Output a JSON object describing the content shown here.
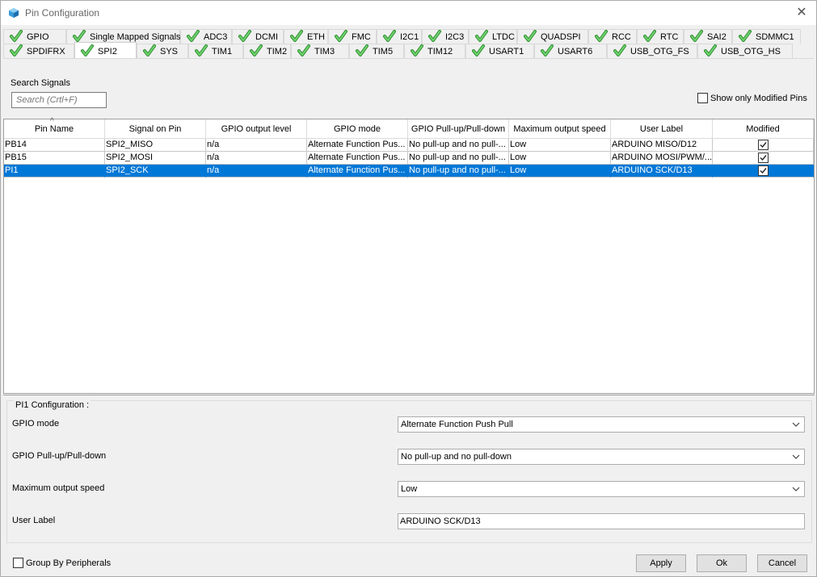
{
  "window": {
    "title": "Pin Configuration"
  },
  "tabs_row1": [
    "GPIO",
    "Single Mapped Signals",
    "ADC3",
    "DCMI",
    "ETH",
    "FMC",
    "I2C1",
    "I2C3",
    "LTDC",
    "QUADSPI",
    "RCC",
    "RTC",
    "SAI2",
    "SDMMC1"
  ],
  "tabs_row2": [
    "SPDIFRX",
    "SPI2",
    "SYS",
    "TIM1",
    "TIM2",
    "TIM3",
    "TIM5",
    "TIM12",
    "USART1",
    "USART6",
    "USB_OTG_FS",
    "USB_OTG_HS"
  ],
  "active_tab": "SPI2",
  "search": {
    "label": "Search Signals",
    "placeholder": "Search (Crtl+F)"
  },
  "show_modified": {
    "label": "Show only Modified Pins",
    "checked": false
  },
  "table": {
    "headers": [
      "Pin Name",
      "Signal on Pin",
      "GPIO output level",
      "GPIO mode",
      "GPIO Pull-up/Pull-down",
      "Maximum output speed",
      "User Label",
      "Modified"
    ],
    "rows": [
      [
        "PB14",
        "SPI2_MISO",
        "n/a",
        "Alternate Function Pus...",
        "No pull-up and no pull-...",
        "Low",
        "ARDUINO MISO/D12",
        true
      ],
      [
        "PB15",
        "SPI2_MOSI",
        "n/a",
        "Alternate Function Pus...",
        "No pull-up and no pull-...",
        "Low",
        "ARDUINO MOSI/PWM/...",
        true
      ],
      [
        "PI1",
        "SPI2_SCK",
        "n/a",
        "Alternate Function Pus...",
        "No pull-up and no pull-...",
        "Low",
        "ARDUINO SCK/D13",
        true
      ]
    ],
    "selected_row": 2
  },
  "config": {
    "title": "PI1 Configuration :",
    "fields": {
      "gpio_mode": {
        "label": "GPIO mode",
        "value": "Alternate Function Push Pull"
      },
      "pull": {
        "label": "GPIO Pull-up/Pull-down",
        "value": "No pull-up and no pull-down"
      },
      "speed": {
        "label": "Maximum output speed",
        "value": "Low"
      },
      "user_label": {
        "label": "User Label",
        "value": "ARDUINO SCK/D13"
      }
    }
  },
  "group_by": {
    "label": "Group By Peripherals",
    "checked": false
  },
  "buttons": {
    "apply": "Apply",
    "ok": "Ok",
    "cancel": "Cancel"
  },
  "colors": {
    "selection": "#0078d7",
    "check_green": "#3cb43c"
  },
  "icons": {
    "tab_status": "green-check-icon",
    "app": "cube-icon",
    "close": "close-icon",
    "dropdown": "chevron-down-icon"
  }
}
